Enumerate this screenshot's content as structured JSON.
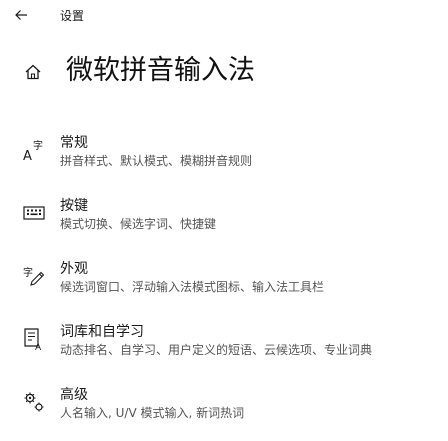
{
  "window": {
    "title": "设置"
  },
  "header": {
    "title": "微软拼音输入法"
  },
  "items": [
    {
      "icon": "font-a-icon",
      "label": "常规",
      "description": "拼音样式、默认模式、模糊拼音规则"
    },
    {
      "icon": "keyboard-icon",
      "label": "按键",
      "description": "模式切换、候选字词、快捷键"
    },
    {
      "icon": "pen-character-icon",
      "label": "外观",
      "description": "候选词窗口、浮动输入法模式图标、输入法工具栏"
    },
    {
      "icon": "dictionary-icon",
      "label": "词库和自学习",
      "description": "动态排名、自学习、用户定义的短语、云候选项、专业词典"
    },
    {
      "icon": "advanced-gears-icon",
      "label": "高级",
      "description": "人名输入, U/V 模式输入, 新词热词"
    }
  ]
}
